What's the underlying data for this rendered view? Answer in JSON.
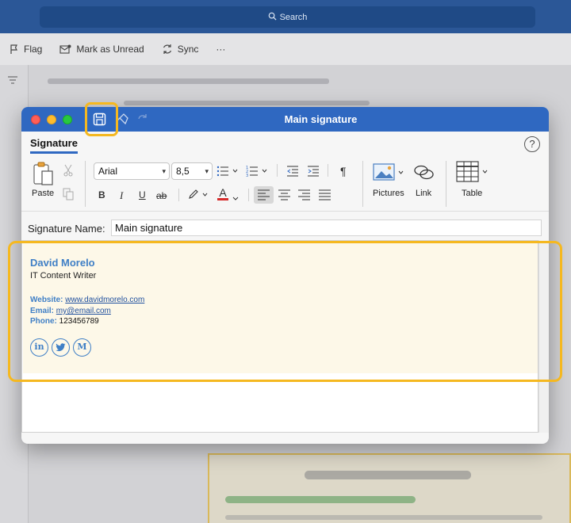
{
  "app": {
    "search_label": "Search",
    "toolbar": {
      "flag": "Flag",
      "mark_unread": "Mark as Unread",
      "sync": "Sync",
      "more": "···"
    }
  },
  "window": {
    "title": "Main signature",
    "tab": "Signature",
    "help": "?"
  },
  "ribbon": {
    "paste_label": "Paste",
    "font": "Arial",
    "font_size": "8,5",
    "bold": "B",
    "italic": "I",
    "underline": "U",
    "strike": "ab",
    "font_color_letter": "A",
    "paragraph_mark": "¶",
    "pictures_label": "Pictures",
    "link_label": "Link",
    "table_label": "Table",
    "font_color": "#d62b2b"
  },
  "signature_name": {
    "label": "Signature Name:",
    "value": "Main signature"
  },
  "signature": {
    "name": "David Morelo",
    "role": "IT Content Writer",
    "website_label": "Website:",
    "website": "www.davidmorelo.com",
    "email_label": "Email:",
    "email": "my@email.com",
    "phone_label": "Phone:",
    "phone": "123456789",
    "social": [
      "in",
      "t",
      "M"
    ],
    "accent_color": "#3f7fc6"
  },
  "highlight_color": "#f5b820"
}
